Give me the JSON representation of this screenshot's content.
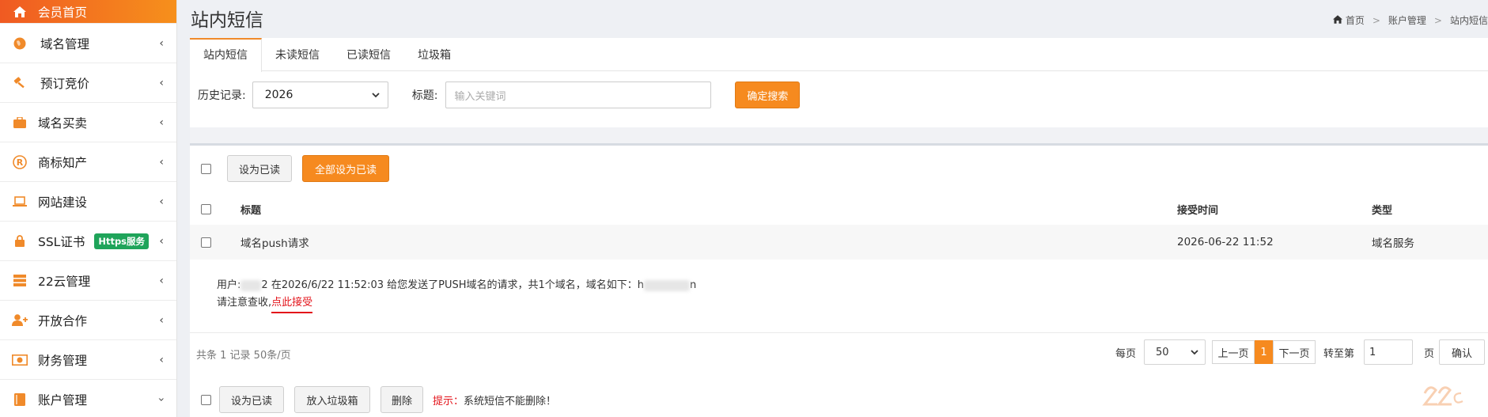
{
  "sidebar": {
    "items": [
      {
        "label": "会员首页",
        "icon": "home-icon",
        "active": true
      },
      {
        "label": "域名管理",
        "icon": "globe-icon"
      },
      {
        "label": "预订竞价",
        "icon": "gavel-icon"
      },
      {
        "label": "域名买卖",
        "icon": "briefcase-icon"
      },
      {
        "label": "商标知产",
        "icon": "registered-icon"
      },
      {
        "label": "网站建设",
        "icon": "laptop-icon"
      },
      {
        "label": "SSL证书",
        "icon": "lock-icon",
        "badge": "Https服务"
      },
      {
        "label": "22云管理",
        "icon": "server-icon"
      },
      {
        "label": "开放合作",
        "icon": "user-plus-icon"
      },
      {
        "label": "财务管理",
        "icon": "money-icon"
      },
      {
        "label": "账户管理",
        "icon": "book-icon"
      }
    ]
  },
  "header": {
    "title": "站内短信",
    "breadcrumb": [
      "首页",
      "账户管理",
      "站内短信"
    ]
  },
  "tabs": [
    "站内短信",
    "未读短信",
    "已读短信",
    "垃圾箱"
  ],
  "filter": {
    "history_label": "历史记录:",
    "history_value": "2026",
    "title_label": "标题:",
    "title_placeholder": "输入关键词",
    "search_button": "确定搜索"
  },
  "toolbar": {
    "mark_read": "设为已读",
    "mark_all_read": "全部设为已读"
  },
  "table": {
    "columns": [
      "标题",
      "接受时间",
      "类型"
    ],
    "rows": [
      {
        "title": "域名push请求",
        "time": "2026-06-22 11:52",
        "type": "域名服务"
      }
    ]
  },
  "message": {
    "prefix": "用户:",
    "masked_user_suffix": "2",
    "sent_text": "在2026/6/22 11:52:03 给您发送了PUSH域名的请求，共1个域名，域名如下：",
    "domain_prefix": "h",
    "domain_suffix": "n",
    "notice": "请注意查收,",
    "accept_link": "点此接受"
  },
  "pagination": {
    "summary": "共条 1 记录 50条/页",
    "per_page_label": "每页",
    "per_page_value": "50",
    "prev": "上一页",
    "current": "1",
    "next": "下一页",
    "goto_label": "转至第",
    "goto_value": "1",
    "page_unit": "页",
    "confirm": "确认"
  },
  "bottom_actions": {
    "mark_read": "设为已读",
    "move_trash": "放入垃圾箱",
    "delete": "删除",
    "tip_label": "提示：",
    "tip_text": "系统短信不能删除！"
  },
  "colors": {
    "accent": "#f68a1f",
    "sidebar_active_start": "#f05a22",
    "link_red": "#e3141b",
    "badge_green": "#1fa45a"
  }
}
